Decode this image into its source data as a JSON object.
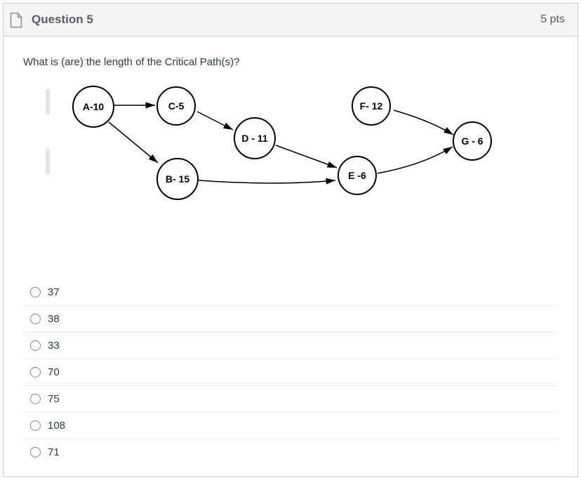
{
  "header": {
    "title": "Question 5",
    "points": "5 pts"
  },
  "question_text": "What is (are) the length of the Critical Path(s)?",
  "diagram": {
    "nodes": {
      "a": "A-10",
      "b": "B- 15",
      "c": "C-5",
      "d": "D - 11",
      "e": "E -6",
      "f": "F- 12",
      "g": "G - 6"
    },
    "edges": [
      {
        "from": "A",
        "to": "C"
      },
      {
        "from": "A",
        "to": "B"
      },
      {
        "from": "C",
        "to": "D"
      },
      {
        "from": "B",
        "to": "E"
      },
      {
        "from": "D",
        "to": "E"
      },
      {
        "from": "E",
        "to": "G"
      },
      {
        "from": "F",
        "to": "G"
      }
    ]
  },
  "answers": [
    {
      "label": "37"
    },
    {
      "label": "38"
    },
    {
      "label": "33"
    },
    {
      "label": "70"
    },
    {
      "label": "75"
    },
    {
      "label": "108"
    },
    {
      "label": "71"
    }
  ]
}
